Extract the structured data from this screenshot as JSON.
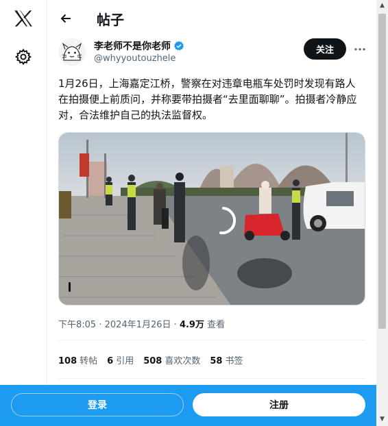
{
  "app": {
    "logo_icon": "x-logo-icon"
  },
  "nav": {
    "settings_icon": "gear-icon"
  },
  "header": {
    "title": "帖子"
  },
  "post": {
    "author_name": "李老师不是你老师",
    "handle": "@whyyoutouzhele",
    "follow_label": "关注",
    "text": "1月26日，上海嘉定江桥，警察在对违章电瓶车处罚时发现有路人在拍摄便上前质问，并称要带拍摄者“去里面聊聊”。拍摄者冷静应对，合法维护自己的执法监督权。",
    "time": "下午8:05",
    "dot1": "·",
    "date": "2024年1月26日",
    "dot2": "·",
    "views": "4.9万",
    "views_label": "查看"
  },
  "stats": [
    {
      "value": "108",
      "label": "转帖"
    },
    {
      "value": "6",
      "label": "引用"
    },
    {
      "value": "508",
      "label": "喜欢次数"
    },
    {
      "value": "58",
      "label": "书签"
    }
  ],
  "bottom": {
    "login_label": "登录",
    "signup_label": "注册"
  },
  "colors": {
    "accent": "#1d9bf0",
    "text": "#0f1419",
    "muted": "#536471"
  }
}
